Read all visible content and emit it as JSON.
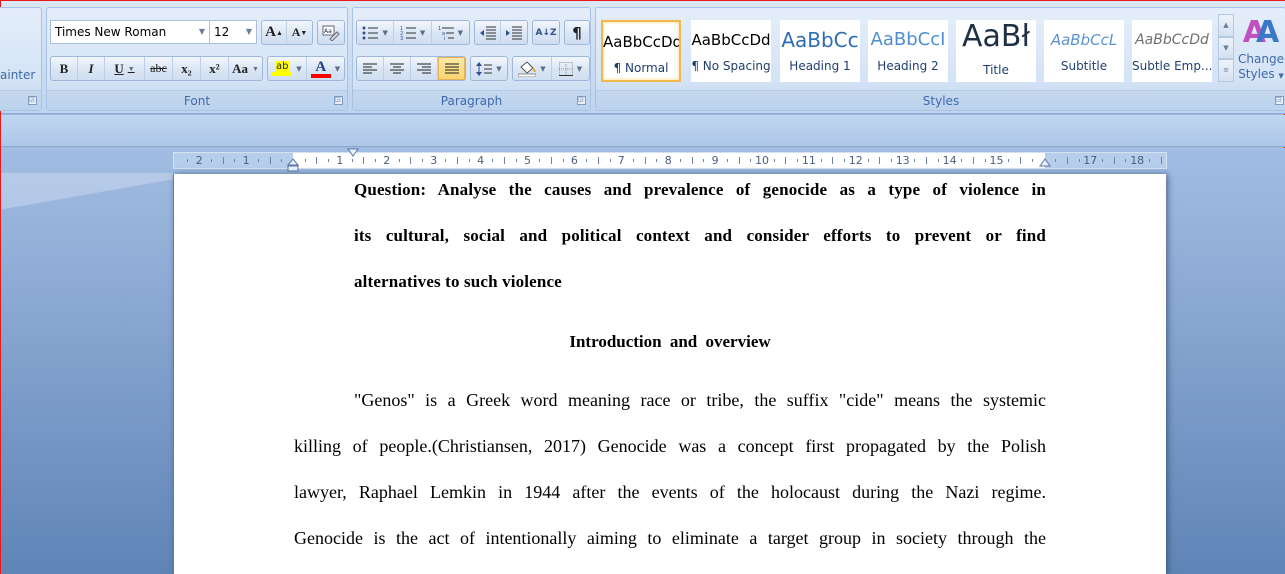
{
  "ribbon": {
    "clipboard": {
      "painter_label": "ainter"
    },
    "font": {
      "group_label": "Font",
      "font_name": "Times New Roman",
      "font_size": "12",
      "grow_font": "A",
      "shrink_font": "A",
      "bold": "B",
      "italic": "I",
      "underline": "U",
      "strikethrough": "abc",
      "subscript": "x₂",
      "superscript": "x²",
      "change_case": "Aa",
      "highlight": "ab",
      "font_color": "A",
      "highlight_color": "#ffff00",
      "font_color_value": "#ff0000"
    },
    "paragraph": {
      "group_label": "Paragraph",
      "pilcrow": "¶",
      "sort": "A↓Z"
    },
    "styles": {
      "group_label": "Styles",
      "items": [
        {
          "sample": "AaBbCcDd",
          "name": "¶ Normal",
          "selected": true
        },
        {
          "sample": "AaBbCcDd",
          "name": "¶ No Spacing"
        },
        {
          "sample": "AaBbCc",
          "name": "Heading 1"
        },
        {
          "sample": "AaBbCcI",
          "name": "Heading 2"
        },
        {
          "sample": "AaBł",
          "name": "Title"
        },
        {
          "sample": "AaBbCcL",
          "name": "Subtitle"
        },
        {
          "sample": "AaBbCcDd",
          "name": "Subtle Emp..."
        }
      ],
      "change_styles_label_1": "Change",
      "change_styles_label_2": "Styles"
    }
  },
  "ruler": {
    "left_numbers": [
      "2",
      "1"
    ],
    "right_numbers": [
      "1",
      "2",
      "3",
      "4",
      "5",
      "6",
      "7",
      "8",
      "9",
      "10",
      "11",
      "12",
      "13",
      "14",
      "15"
    ],
    "margin_numbers": [
      "17",
      "18"
    ]
  },
  "document": {
    "question_lines": [
      "Question: Analyse the causes and prevalence of genocide as a type of violence in",
      "its cultural, social and political context and consider efforts to prevent or find",
      "alternatives to such violence"
    ],
    "heading": "Introduction and overview",
    "body_lines": [
      "\"Genos\" is a Greek word meaning race or tribe, the suffix \"cide\" means the systemic",
      "killing of people.(Christiansen, 2017) Genocide was a concept first propagated by the Polish",
      "lawyer, Raphael Lemkin in 1944 after the events of the holocaust during the Nazi regime.",
      "Genocide is the act of intentionally aiming to eliminate a target group in society through the"
    ]
  }
}
